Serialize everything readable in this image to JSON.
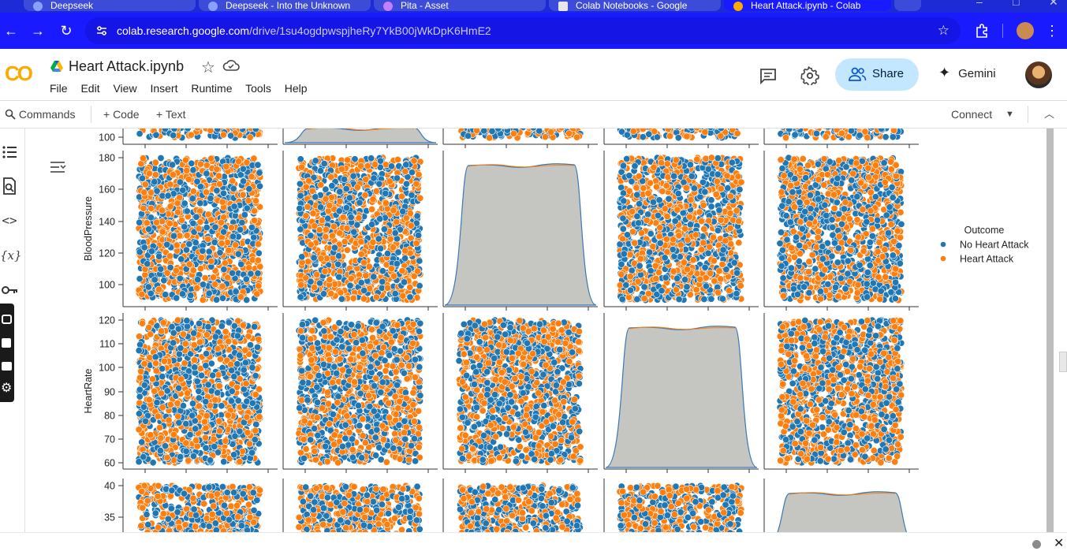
{
  "browser": {
    "tabs": [
      {
        "label": "Deepseek"
      },
      {
        "label": "Deepseek - Into the Unknown"
      },
      {
        "label": "Pita - Asset"
      },
      {
        "label": "Colab Notebooks - Google"
      },
      {
        "label": "Heart Attack.ipynb - Colab"
      }
    ],
    "url_host": "colab.research.google.com",
    "url_path": "/drive/1su4ogdpwspjheRy7YkB00jWkDpK6HmE2"
  },
  "colab": {
    "logo": "CO",
    "notebook_title": "Heart Attack.ipynb",
    "menu": [
      "File",
      "Edit",
      "View",
      "Insert",
      "Runtime",
      "Tools",
      "Help"
    ],
    "share_label": "Share",
    "gemini_label": "Gemini",
    "toolbar": {
      "commands": "Commands",
      "add_code": "+ Code",
      "add_text": "+ Text",
      "connect": "Connect"
    }
  },
  "colors": {
    "no_heart_attack": "#1f77b4",
    "heart_attack": "#ff7f0e",
    "kde_fill": "#c5c5c2",
    "browser_blue": "#1a1aff"
  },
  "chart_data": {
    "type": "scatter",
    "description_kind": "pairplot",
    "legend": {
      "title": "Outcome",
      "placement": "right",
      "entries": [
        {
          "name": "No Heart Attack",
          "color": "#1f77b4"
        },
        {
          "name": "Heart Attack",
          "color": "#ff7f0e"
        }
      ]
    },
    "rows": [
      {
        "label": "",
        "ticks": [
          "100"
        ],
        "range": [
          90,
          180
        ]
      },
      {
        "label": "BloodPressure",
        "ticks": [
          "180",
          "160",
          "140",
          "120",
          "100"
        ],
        "range": [
          90,
          180
        ]
      },
      {
        "label": "HeartRate",
        "ticks": [
          "120",
          "110",
          "100",
          "90",
          "80",
          "70",
          "60"
        ],
        "range": [
          60,
          120
        ]
      },
      {
        "label": "",
        "ticks": [
          "40",
          "35"
        ],
        "range": [
          30,
          40
        ]
      }
    ],
    "diagonal_panels": [
      {
        "row": 0,
        "col": 1
      },
      {
        "row": 1,
        "col": 2
      },
      {
        "row": 2,
        "col": 3
      },
      {
        "row": 3,
        "col": 4
      }
    ],
    "columns": 5
  }
}
